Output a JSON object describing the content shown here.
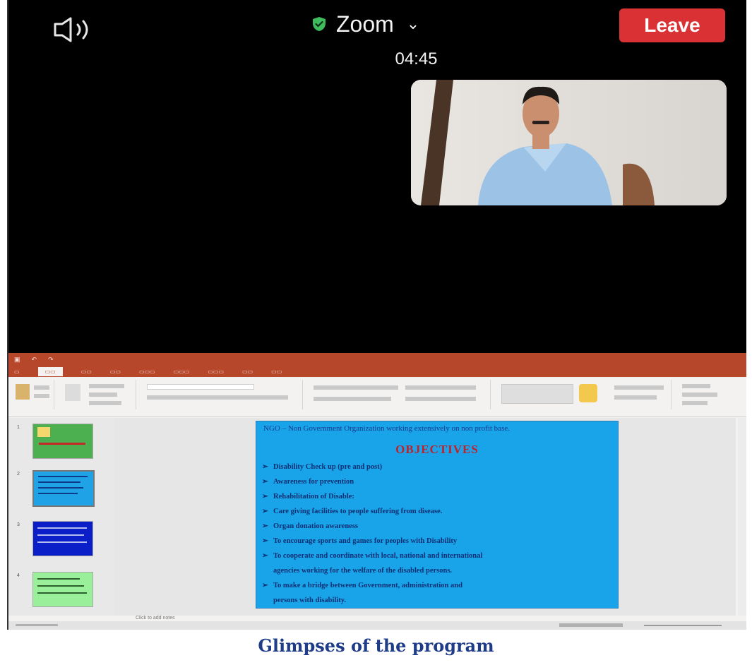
{
  "zoom": {
    "app_name": "Zoom",
    "timer": "04:45",
    "leave_label": "Leave",
    "leave_color": "#d93134",
    "shield_color": "#3dbb5d",
    "icons": [
      "speaker-icon",
      "shield-icon",
      "chevron-down-icon"
    ]
  },
  "slide": {
    "intro": "NGO – Non Government Organization working extensively on non profit base.",
    "heading": "OBJECTIVES",
    "bullets": [
      "Disability Check up (pre and post)",
      "Awareness for prevention",
      "Rehabilitation of Disable:",
      "Care giving facilities to people suffering from disease.",
      "Organ donation awareness",
      "To encourage sports and games for peoples with Disability",
      "To cooperate and coordinate with local, national and international",
      "agencies working for the welfare of the disabled persons.",
      "To make a bridge between Government, administration and",
      "persons with disability."
    ],
    "bullet_arrows": [
      true,
      true,
      true,
      true,
      true,
      true,
      true,
      false,
      true,
      false
    ],
    "bg_color": "#19a4ea"
  },
  "ppt": {
    "notes_placeholder": "Click to add notes",
    "accent": "#b7472a"
  },
  "caption": "Glimpses of the program"
}
